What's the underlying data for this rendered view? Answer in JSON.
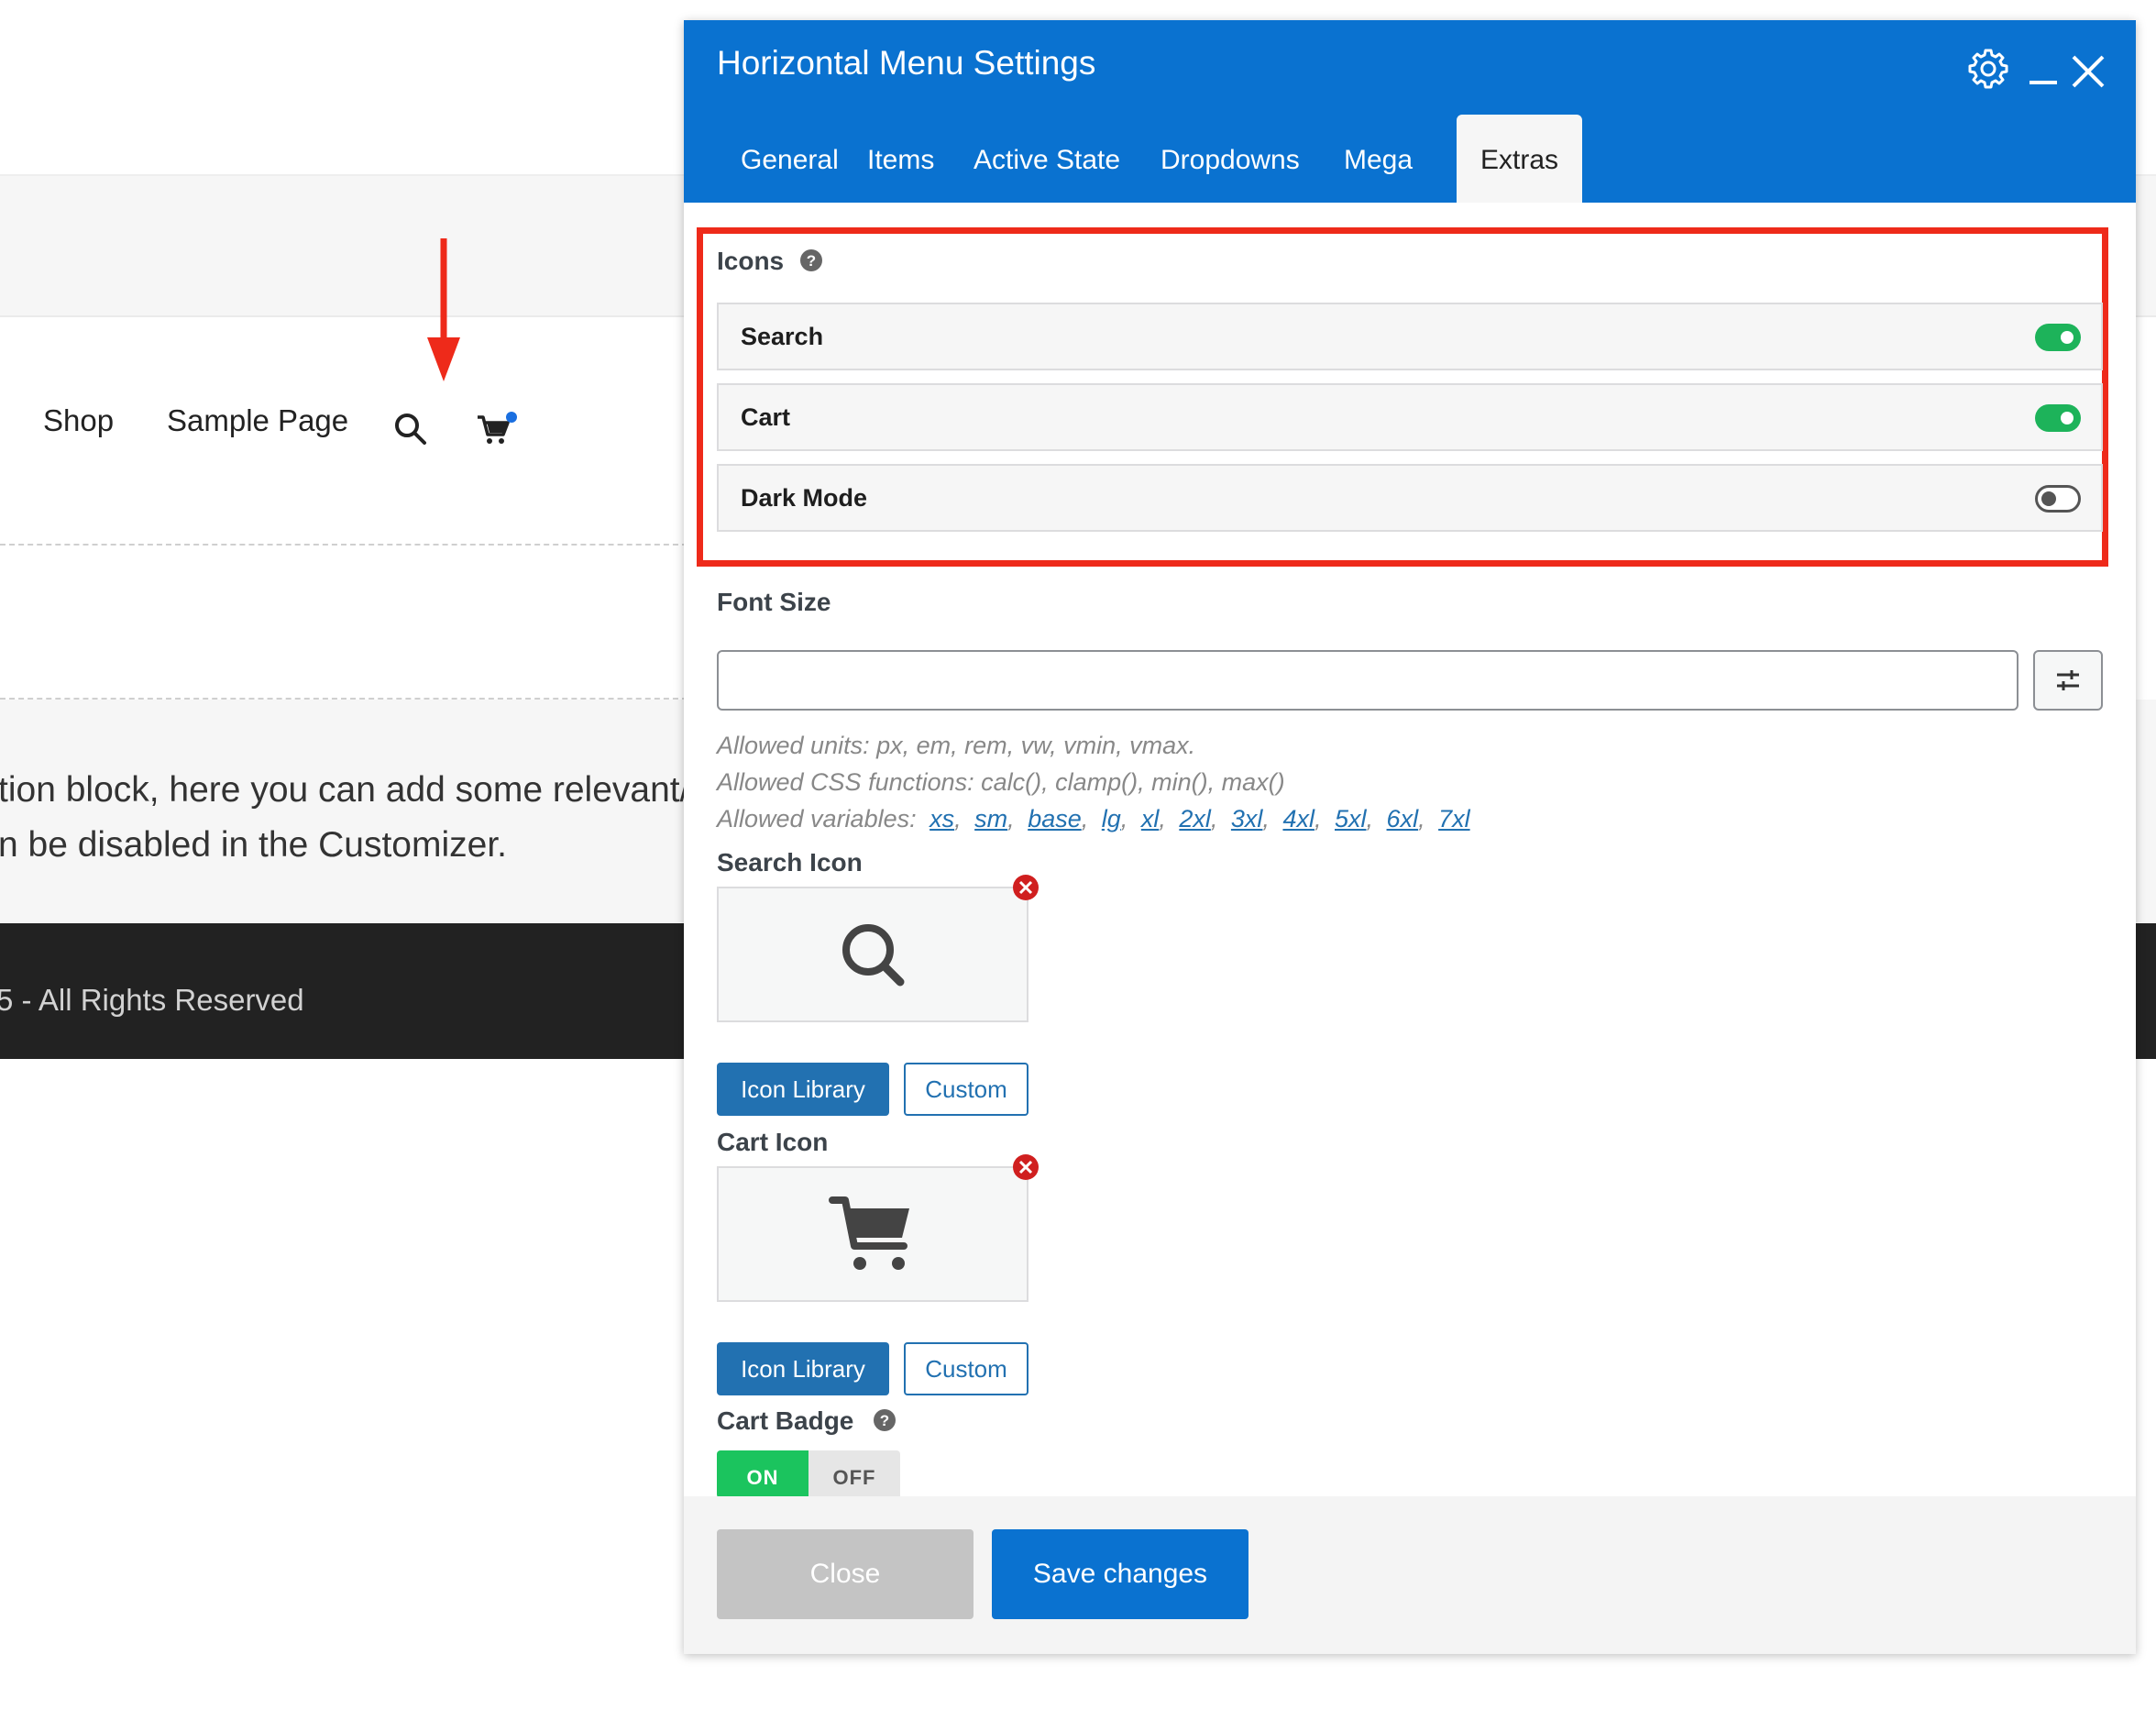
{
  "site": {
    "nav": {
      "shop": "Shop",
      "sample_page": "Sample Page"
    },
    "content_line1": "tion block, here you can add some relevant/",
    "content_line2": "n be disabled in the Customizer.",
    "footer": "5 - All Rights Reserved"
  },
  "modal": {
    "title": "Horizontal Menu Settings",
    "tabs": [
      "General",
      "Items",
      "Active State",
      "Dropdowns",
      "Mega",
      "Extras"
    ],
    "active_tab": "Extras",
    "icons_section": {
      "label": "Icons",
      "rows": [
        {
          "label": "Search",
          "enabled": true
        },
        {
          "label": "Cart",
          "enabled": true
        },
        {
          "label": "Dark Mode",
          "enabled": false
        }
      ]
    },
    "font_size": {
      "label": "Font Size",
      "value": "",
      "hint_units": "Allowed units: px, em, rem, vw, vmin, vmax.",
      "hint_functions": "Allowed CSS functions: calc(), clamp(), min(), max()",
      "hint_variables_label": "Allowed variables:",
      "variables": [
        "xs",
        "sm",
        "base",
        "lg",
        "xl",
        "2xl",
        "3xl",
        "4xl",
        "5xl",
        "6xl",
        "7xl"
      ]
    },
    "search_icon": {
      "label": "Search Icon",
      "icon": "magnifier-icon",
      "library_button": "Icon Library",
      "custom_button": "Custom"
    },
    "cart_icon": {
      "label": "Cart Icon",
      "icon": "cart-icon",
      "library_button": "Icon Library",
      "custom_button": "Custom"
    },
    "cart_badge": {
      "label": "Cart Badge",
      "on_label": "ON",
      "off_label": "OFF",
      "value": "ON"
    },
    "footer": {
      "close": "Close",
      "save": "Save changes"
    }
  },
  "colors": {
    "header": "#0a72d0",
    "highlight": "#ee2a1a",
    "toggle_on": "#1db35a",
    "link": "#2271b1"
  }
}
